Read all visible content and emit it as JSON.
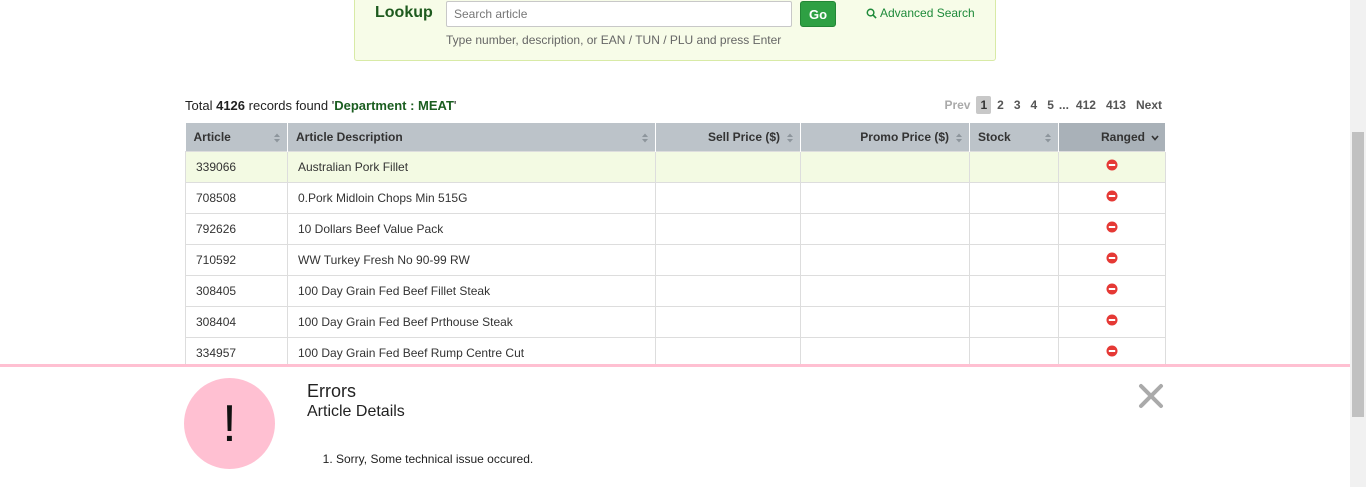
{
  "lookup": {
    "title": "Lookup",
    "search_placeholder": "Search article",
    "search_value": "",
    "go_label": "Go",
    "advanced_search_label": "Advanced Search",
    "hint": "Type number, description, or EAN / TUN / PLU and press Enter"
  },
  "summary": {
    "prefix": "Total",
    "count": "4126",
    "middle": "records found '",
    "filter": "Department : MEAT",
    "suffix": "'"
  },
  "pagination": {
    "prev": "Prev",
    "pages": [
      "1",
      "2",
      "3",
      "4",
      "5"
    ],
    "ellipsis": "...",
    "last_pages": [
      "412",
      "413"
    ],
    "next": "Next",
    "current": "1"
  },
  "table": {
    "columns": [
      "Article",
      "Article Description",
      "Sell Price ($)",
      "Promo Price ($)",
      "Stock",
      "Ranged"
    ],
    "rows": [
      {
        "article": "339066",
        "description": "Australian Pork Fillet",
        "sell": "",
        "promo": "",
        "stock": "",
        "ranged": "not-ranged-icon"
      },
      {
        "article": "708508",
        "description": "0.Pork Midloin Chops Min 515G",
        "sell": "",
        "promo": "",
        "stock": "",
        "ranged": "not-ranged-icon"
      },
      {
        "article": "792626",
        "description": "10 Dollars Beef Value Pack",
        "sell": "",
        "promo": "",
        "stock": "",
        "ranged": "not-ranged-icon"
      },
      {
        "article": "710592",
        "description": "WW Turkey Fresh No 90-99 RW",
        "sell": "",
        "promo": "",
        "stock": "",
        "ranged": "not-ranged-icon"
      },
      {
        "article": "308405",
        "description": "100 Day Grain Fed Beef Fillet Steak",
        "sell": "",
        "promo": "",
        "stock": "",
        "ranged": "not-ranged-icon"
      },
      {
        "article": "308404",
        "description": "100 Day Grain Fed Beef Prthouse Steak",
        "sell": "",
        "promo": "",
        "stock": "",
        "ranged": "not-ranged-icon"
      },
      {
        "article": "334957",
        "description": "100 Day Grain Fed Beef Rump Centre Cut",
        "sell": "",
        "promo": "",
        "stock": "",
        "ranged": "not-ranged-icon"
      }
    ]
  },
  "error": {
    "icon_text": "!",
    "title": "Errors",
    "subtitle": "Article Details",
    "messages": [
      "Sorry, Some technical issue occured."
    ]
  },
  "colors": {
    "accent_green": "#2ea043",
    "error_pink": "#ffc0d2",
    "not_ranged_red": "#e53935",
    "header_gray": "#bcc3c9"
  }
}
